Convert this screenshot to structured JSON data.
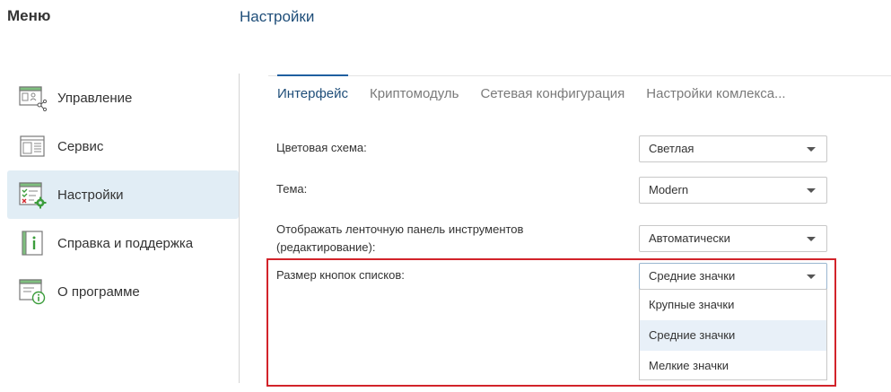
{
  "menu": {
    "title": "Меню"
  },
  "page": {
    "title": "Настройки"
  },
  "sidebar": {
    "items": [
      {
        "label": "Управление",
        "icon": "management-icon",
        "active": false
      },
      {
        "label": "Сервис",
        "icon": "service-icon",
        "active": false
      },
      {
        "label": "Настройки",
        "icon": "settings-icon",
        "active": true
      },
      {
        "label": "Справка и поддержка",
        "icon": "help-icon",
        "active": false
      },
      {
        "label": "О программе",
        "icon": "about-icon",
        "active": false
      }
    ]
  },
  "tabs": [
    {
      "label": "Интерфейс",
      "active": true
    },
    {
      "label": "Криптомодуль",
      "active": false
    },
    {
      "label": "Сетевая конфигурация",
      "active": false
    },
    {
      "label": "Настройки комлекса...",
      "active": false
    }
  ],
  "settings": {
    "color_scheme": {
      "label": "Цветовая схема:",
      "value": "Светлая"
    },
    "theme": {
      "label": "Тема:",
      "value": "Modern"
    },
    "ribbon": {
      "label_line1": "Отображать ленточную панель инструментов",
      "label_line2": "(редактирование):",
      "value": "Автоматически"
    },
    "list_button_size": {
      "label": "Размер кнопок списков:",
      "value": "Средние значки",
      "options": [
        "Крупные значки",
        "Средние значки",
        "Мелкие значки"
      ],
      "selected_option": "Средние значки"
    }
  },
  "colors": {
    "accent": "#1f4e79",
    "active_tab_line": "#1f5fa0",
    "sidebar_active_bg": "#e1edf5",
    "highlight_border": "#d2232a",
    "icon_green": "#3c9d3c"
  }
}
